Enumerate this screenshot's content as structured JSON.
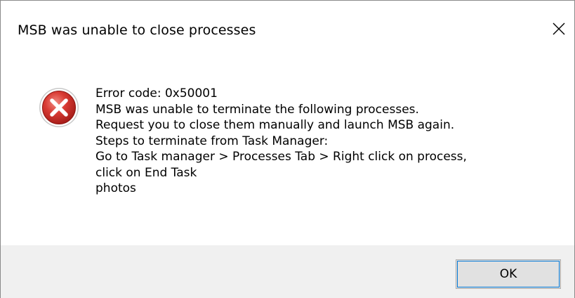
{
  "dialog": {
    "title": "MSB was unable to close processes",
    "close_icon": "close-icon",
    "icon": "error-icon",
    "message_lines": [
      "Error code: 0x50001",
      "MSB was unable to terminate the following processes.",
      "Request you to close them manually and launch MSB again.",
      "Steps to terminate from Task Manager:",
      "Go to Task manager > Processes Tab > Right click on process,",
      "click on End Task",
      "photos"
    ],
    "ok_label": "OK"
  },
  "colors": {
    "error_red": "#d32f2f",
    "footer_bg": "#f0f0f0",
    "button_bg": "#e1e1e1",
    "button_focus": "#0078d7"
  }
}
